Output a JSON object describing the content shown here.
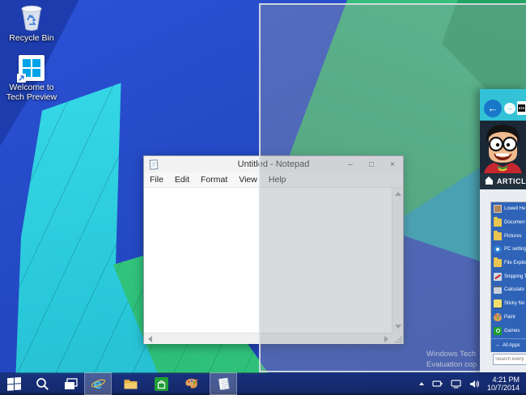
{
  "desktop": {
    "icons": [
      {
        "label": "Recycle Bin",
        "icon": "recycle-bin"
      },
      {
        "label": "Welcome to Tech Preview",
        "icon": "windows-tile-shortcut"
      }
    ],
    "watermark": {
      "line1": "Windows Tech",
      "line2": "Evaluation cop"
    }
  },
  "notepad": {
    "title": "Untitled - Notepad",
    "menu_items": [
      "File",
      "Edit",
      "Format",
      "View",
      "Help"
    ],
    "controls": {
      "minimize": "–",
      "maximize": "□",
      "close": "×"
    }
  },
  "browser": {
    "favicon_text": "HTG",
    "article_bar_label": "ARTICL",
    "start_menu": {
      "items": [
        {
          "label": "Lowell He",
          "icon": "ic-user"
        },
        {
          "label": "Documen",
          "icon": "ic-folder"
        },
        {
          "label": "Pictures",
          "icon": "ic-folder"
        },
        {
          "label": "PC setting",
          "icon": "ic-settings"
        },
        {
          "label": "File Explor",
          "icon": "ic-folder"
        },
        {
          "label": "Snipping T",
          "icon": "ic-snip"
        },
        {
          "label": "Calculato",
          "icon": "ic-calc"
        },
        {
          "label": "Sticky No",
          "icon": "ic-sticky"
        },
        {
          "label": "Paint",
          "icon": "ic-paint"
        },
        {
          "label": "Games",
          "icon": "ic-games"
        }
      ],
      "all_apps_label": "All Apps",
      "all_apps_arrow": "→",
      "search_placeholder": "Search every"
    },
    "nav": {
      "back_glyph": "←",
      "forward_glyph": "→"
    }
  },
  "taskbar": {
    "buttons": [
      "start",
      "search",
      "task-view",
      "internet-explorer",
      "file-explorer",
      "store",
      "paint",
      "notepad"
    ],
    "open_apps": [
      "internet-explorer",
      "notepad"
    ],
    "tray": [
      "hidden-icons-chevron",
      "power",
      "network",
      "volume"
    ],
    "clock": {
      "time": "4:21 PM",
      "date": "10/7/2014"
    }
  },
  "colors": {
    "wallpaper_blue": "#2b52d6",
    "wallpaper_cyan": "#30d6e4",
    "wallpaper_green": "#2eb873",
    "wallpaper_teal": "#1ba4ba",
    "browser_chrome_teal": "#33c2d6",
    "back_button_blue": "#1877c9",
    "start_menu_panel_blue": "#2e63b8",
    "store_green": "#1f9e35",
    "snap_overlay_tint": "rgba(152,158,165,0.38)"
  }
}
